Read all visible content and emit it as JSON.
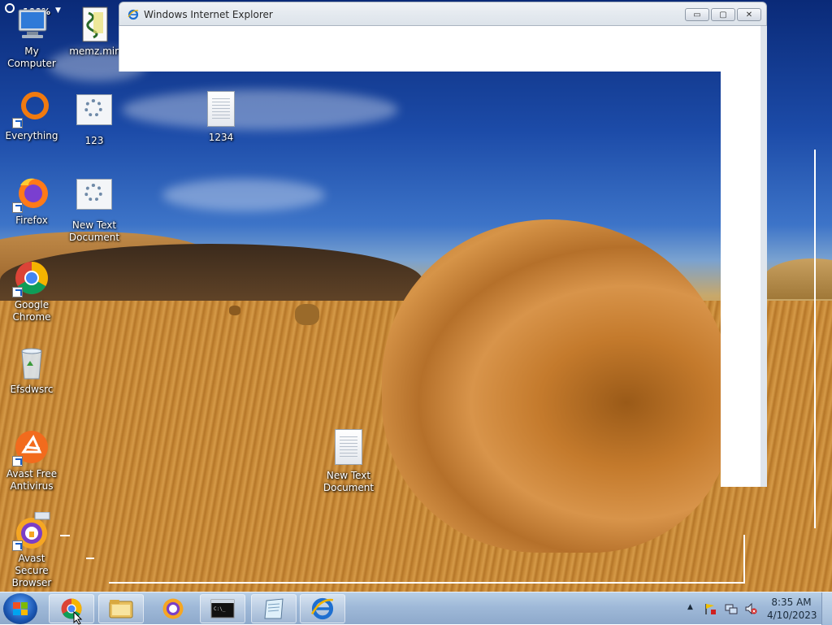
{
  "desktop": {
    "zoom_overlay": "100%",
    "icons": [
      {
        "label": "My Computer",
        "icon": "computer-icon"
      },
      {
        "label": "memz.min",
        "icon": "script-file-icon"
      },
      {
        "label": "Everything",
        "icon": "everything-icon"
      },
      {
        "label": "123",
        "icon": "settings-file-icon"
      },
      {
        "label": "1234",
        "icon": "text-document-icon"
      },
      {
        "label": "Firefox",
        "icon": "firefox-icon"
      },
      {
        "label": "New Text Document",
        "icon": "settings-file-icon"
      },
      {
        "label": "Google Chrome",
        "icon": "chrome-icon"
      },
      {
        "label": "Efsdwsrc",
        "icon": "recycle-bin-icon"
      },
      {
        "label": "Avast Free Antivirus",
        "icon": "avast-icon"
      },
      {
        "label": "Avast Secure Browser",
        "icon": "avast-browser-icon"
      },
      {
        "label": "New Text Document",
        "icon": "text-document-icon"
      }
    ]
  },
  "ie_window": {
    "title": "Windows Internet Explorer",
    "minimize": "▭",
    "maximize": "▢",
    "close": "✕"
  },
  "taskbar": {
    "items": [
      {
        "name": "Google Chrome",
        "icon": "chrome-icon"
      },
      {
        "name": "Windows Explorer",
        "icon": "folder-icon"
      },
      {
        "name": "Avast Secure Browser",
        "icon": "avast-browser-icon"
      },
      {
        "name": "Command Prompt",
        "icon": "cmd-icon"
      },
      {
        "name": "Notepad",
        "icon": "notepad-icon"
      },
      {
        "name": "Internet Explorer",
        "icon": "ie-icon"
      }
    ],
    "tray": {
      "show_hidden": "▲",
      "time": "8:35 AM",
      "date": "4/10/2023"
    }
  },
  "colors": {
    "taskbar": "#9fb9d8",
    "ie_blue": "#1e6fd0",
    "chrome_red": "#db4437",
    "chrome_green": "#0f9d58",
    "chrome_yellow": "#f4b400",
    "chrome_blue": "#4285f4",
    "avast_orange": "#f26b1d"
  }
}
